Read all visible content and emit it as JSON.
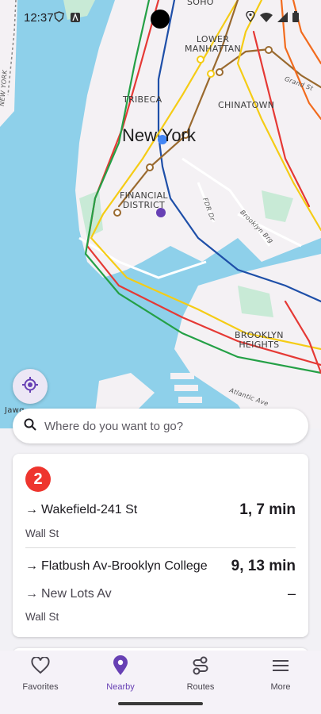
{
  "status_bar": {
    "time": "12:37"
  },
  "map": {
    "labels": {
      "soho": "SOHO",
      "lower_manhattan": "LOWER\nMANHATTAN",
      "tribeca": "TRIBECA",
      "chinatown": "CHINATOWN",
      "new_york": "New York",
      "financial_district": "FINANCIAL\nDISTRICT",
      "brooklyn_heights": "BROOKLYN\nHEIGHTS",
      "grand_st": "Grand St",
      "fdr_dr": "FDR Dr",
      "brooklyn_brg": "Brooklyn Brg",
      "atlantic_av": "Atlantic Ave",
      "new_york_state": "NEW YORK",
      "attribution": "Jawg"
    },
    "colors": {
      "water": "#8ed0ea",
      "land": "#f4f1f4",
      "park": "#c8ead6",
      "red": "#e53935",
      "blue": "#1e4fa8",
      "green": "#24a046",
      "yellow": "#f5cc15",
      "orange": "#f26b1d",
      "brown": "#9a6a2f"
    }
  },
  "search": {
    "placeholder": "Where do you want to go?"
  },
  "card": {
    "route": "2",
    "route_color": "#ee352e",
    "trips": [
      {
        "destination": "Wakefield-241 St",
        "times": "1, 7 min"
      },
      {
        "destination": "Flatbush Av-Brooklyn College",
        "times": "9, 13 min"
      },
      {
        "destination": "New Lots Av",
        "times": "–"
      }
    ],
    "stops": [
      "Wall St",
      "Wall St"
    ]
  },
  "nav": {
    "items": [
      {
        "label": "Favorites",
        "icon": "heart-icon"
      },
      {
        "label": "Nearby",
        "icon": "location-pin-icon",
        "active": true
      },
      {
        "label": "Routes",
        "icon": "routes-icon"
      },
      {
        "label": "More",
        "icon": "menu-icon"
      }
    ]
  }
}
